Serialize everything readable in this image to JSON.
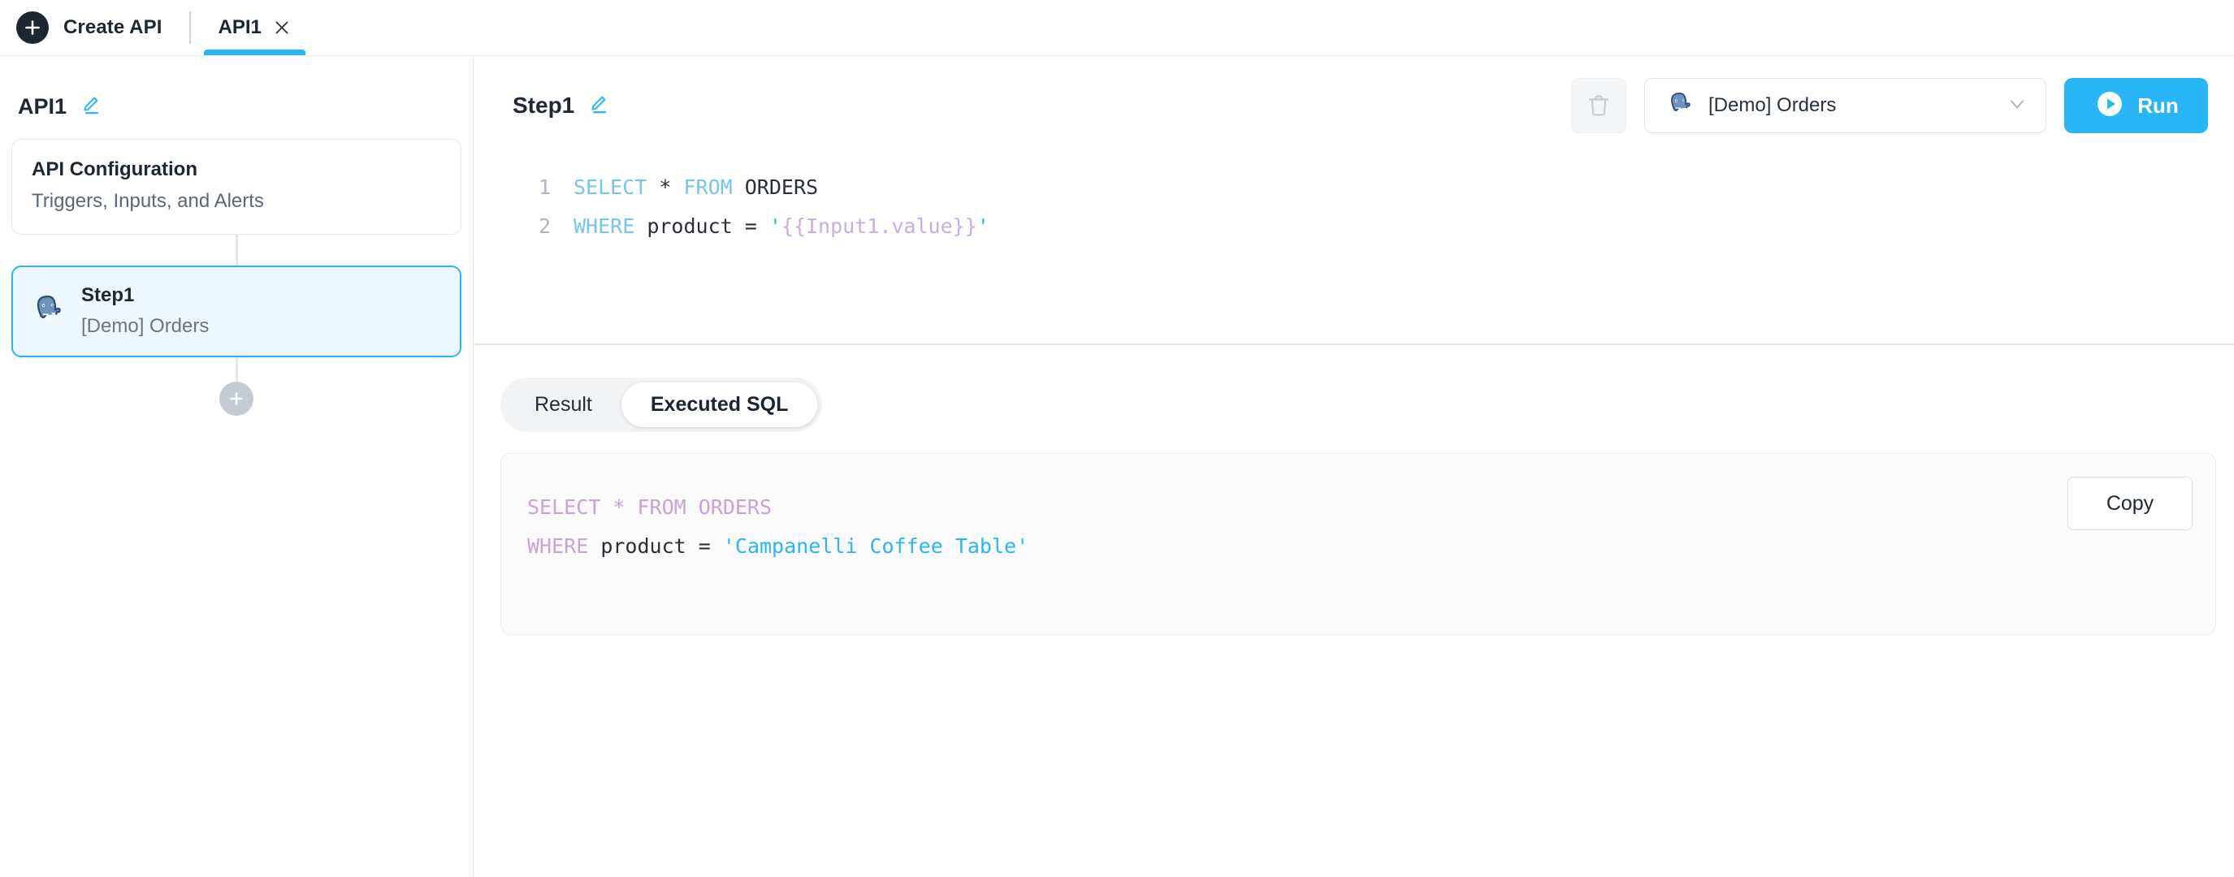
{
  "topbar": {
    "create_api_label": "Create API",
    "plus_icon": "plus-icon",
    "tab": {
      "label": "API1",
      "close_icon": "close-icon"
    }
  },
  "sidebar": {
    "api_name": "API1",
    "edit_icon": "pencil-icon",
    "nodes": [
      {
        "title": "API Configuration",
        "subtitle": "Triggers, Inputs, and Alerts",
        "selected": false
      },
      {
        "title": "Step1",
        "subtitle": "[Demo] Orders",
        "icon": "postgresql-icon",
        "selected": true
      }
    ],
    "add_step_icon": "plus-icon"
  },
  "main": {
    "step_title": "Step1",
    "edit_icon": "pencil-icon",
    "delete_icon": "trash-icon",
    "datasource": {
      "icon": "postgresql-icon",
      "label": "[Demo] Orders",
      "chevron_icon": "chevron-down-icon"
    },
    "run_button": {
      "label": "Run",
      "icon": "play-icon"
    },
    "editor": {
      "lines": [
        {
          "number": "1",
          "tokens": [
            {
              "text": "SELECT",
              "type": "kw"
            },
            {
              "text": " * ",
              "type": "plain"
            },
            {
              "text": "FROM",
              "type": "kw"
            },
            {
              "text": " ORDERS",
              "type": "plain"
            }
          ]
        },
        {
          "number": "2",
          "tokens": [
            {
              "text": "WHERE",
              "type": "kw"
            },
            {
              "text": " product = ",
              "type": "plain"
            },
            {
              "text": "'",
              "type": "str"
            },
            {
              "text": "{{Input1.value}}",
              "type": "tpl"
            },
            {
              "text": "'",
              "type": "str"
            }
          ]
        }
      ]
    },
    "tabs": [
      {
        "label": "Result",
        "active": false
      },
      {
        "label": "Executed SQL",
        "active": true
      }
    ],
    "executed_sql": {
      "line1_kw": "SELECT * FROM ORDERS",
      "line2_kw": "WHERE",
      "line2_mid": " product = ",
      "line2_str": "'Campanelli Coffee Table'",
      "copy_label": "Copy"
    }
  },
  "colors": {
    "accent": "#29b6f6",
    "dark": "#1e2630",
    "sidebar_selected_bg": "#eff7fe",
    "keyword_editor": "#76c5ea",
    "template_var": "#c6aee0",
    "keyword_executed": "#c8a2d8",
    "string": "#29b6f6"
  }
}
